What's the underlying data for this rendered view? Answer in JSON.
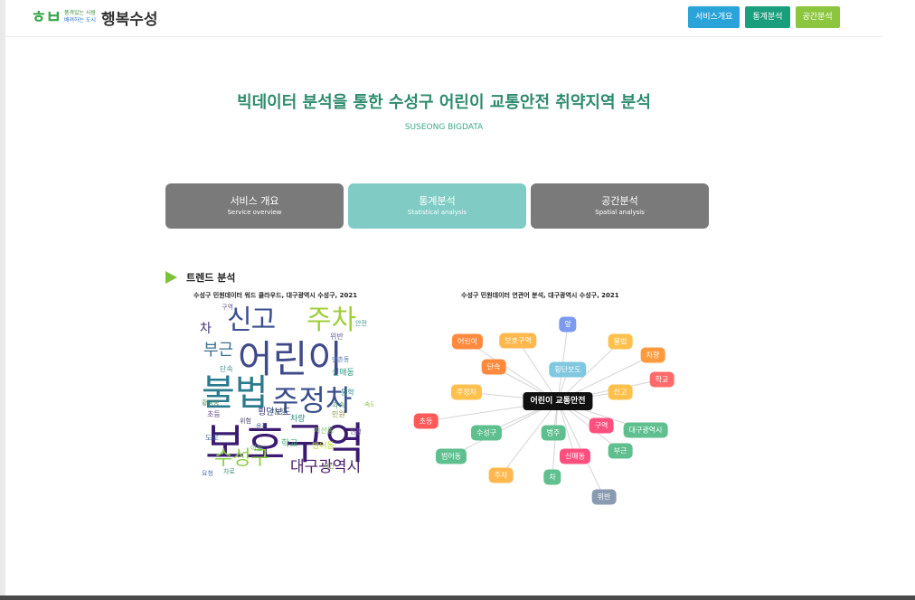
{
  "header": {
    "logo_mark": "ㅎㅂ",
    "logo_slogan_1": "품격있는 사람",
    "logo_slogan_2": "배려하는 도시",
    "logo_name": "행복수성",
    "nav": [
      {
        "label": "서비스개요",
        "color": "#2aa3d8"
      },
      {
        "label": "통계분석",
        "color": "#1a9e7b"
      },
      {
        "label": "공간분석",
        "color": "#8cc63f"
      }
    ]
  },
  "hero": {
    "title": "빅데이터 분석을 통한 수성구 어린이 교통안전 취약지역 분석",
    "subtitle": "SUSEONG BIGDATA"
  },
  "tabs": [
    {
      "ko": "서비스 개요",
      "en": "Service overview",
      "color": "#7a7a7a"
    },
    {
      "ko": "통계분석",
      "en": "Statistical analysis",
      "color": "#80cbc4"
    },
    {
      "ko": "공간분석",
      "en": "Spatial analysis",
      "color": "#7a7a7a"
    }
  ],
  "section": {
    "title": "트렌드 분석",
    "wordcloud_caption": "수성구 민원데이터 워드 클라우드, 대구광역시 수성구, 2021",
    "network_caption": "수성구 민원데이터 연관어 분석, 대구광역시 수성구, 2021"
  },
  "wordcloud": {
    "words": [
      {
        "text": "보호구역",
        "color": "#3b1b70"
      },
      {
        "text": "어린이",
        "color": "#3f4a8a"
      },
      {
        "text": "불법",
        "color": "#2a7b8e"
      },
      {
        "text": "주정차",
        "color": "#3a4e8c"
      },
      {
        "text": "주차",
        "color": "#9fcf3a"
      },
      {
        "text": "신고",
        "color": "#3b4f8f"
      },
      {
        "text": "수성구",
        "color": "#8fcf4a"
      },
      {
        "text": "대구광역시",
        "color": "#4a1f6f"
      },
      {
        "text": "부근",
        "color": "#3d6f8e"
      },
      {
        "text": "횡단보도",
        "color": "#3a3a7a"
      },
      {
        "text": "차",
        "color": "#44307a"
      },
      {
        "text": "차량",
        "color": "#2f8f7a"
      },
      {
        "text": "학교",
        "color": "#4ab06e"
      },
      {
        "text": "범어동",
        "color": "#b9d83a"
      },
      {
        "text": "신매동",
        "color": "#2d9a80"
      },
      {
        "text": "위반",
        "color": "#5a5a8f"
      },
      {
        "text": "단속",
        "color": "#3f8f8a"
      },
      {
        "text": "지산동",
        "color": "#77c05a"
      },
      {
        "text": "초등",
        "color": "#5a3f8a"
      },
      {
        "text": "통학",
        "color": "#2a8a8a"
      },
      {
        "text": "과속",
        "color": "#4a9f6f"
      },
      {
        "text": "민원",
        "color": "#8a8a3a"
      },
      {
        "text": "도로",
        "color": "#3e6f9f"
      },
      {
        "text": "구역",
        "color": "#6a5a9a"
      },
      {
        "text": "황금동",
        "color": "#4f8f5f"
      },
      {
        "text": "만촌동",
        "color": "#5a7ab0"
      },
      {
        "text": "주차장",
        "color": "#3f6f7f"
      },
      {
        "text": "위험",
        "color": "#4a4a6a"
      },
      {
        "text": "안전",
        "color": "#2f9a8f"
      },
      {
        "text": "속도",
        "color": "#8fbf4a"
      },
      {
        "text": "운전",
        "color": "#3a5a8f"
      },
      {
        "text": "시간",
        "color": "#6f8f3f"
      },
      {
        "text": "요청",
        "color": "#4f6faf"
      },
      {
        "text": "차로",
        "color": "#3f8f6f"
      },
      {
        "text": "현장",
        "color": "#7a5a9a"
      },
      {
        "text": "이동",
        "color": "#5faf5f"
      }
    ]
  },
  "network": {
    "center": {
      "label": "어린이 교통안전"
    },
    "nodes": [
      {
        "label": "앞",
        "color": "#7b9bef"
      },
      {
        "label": "어린이",
        "color": "#ff8a3d"
      },
      {
        "label": "보호구역",
        "color": "#ffb84d"
      },
      {
        "label": "불법",
        "color": "#ffc04d"
      },
      {
        "label": "차량",
        "color": "#ff9a3d"
      },
      {
        "label": "단속",
        "color": "#ff8a3d"
      },
      {
        "label": "횡단보도",
        "color": "#7fc8e0"
      },
      {
        "label": "학교",
        "color": "#ff6b6b"
      },
      {
        "label": "주정차",
        "color": "#ffc04d"
      },
      {
        "label": "신고",
        "color": "#ffc04d"
      },
      {
        "label": "초등",
        "color": "#ff5a5a"
      },
      {
        "label": "수성구",
        "color": "#5fbf8f"
      },
      {
        "label": "범주",
        "color": "#5fbf8f"
      },
      {
        "label": "구역",
        "color": "#ff4f7f"
      },
      {
        "label": "대구광역시",
        "color": "#5fbf8f"
      },
      {
        "label": "범어동",
        "color": "#5fbf8f"
      },
      {
        "label": "신매동",
        "color": "#ff4f7f"
      },
      {
        "label": "부근",
        "color": "#5fbf8f"
      },
      {
        "label": "주차",
        "color": "#ffb84d"
      },
      {
        "label": "차",
        "color": "#5fbf8f"
      },
      {
        "label": "위반",
        "color": "#8a9ab0"
      }
    ]
  }
}
